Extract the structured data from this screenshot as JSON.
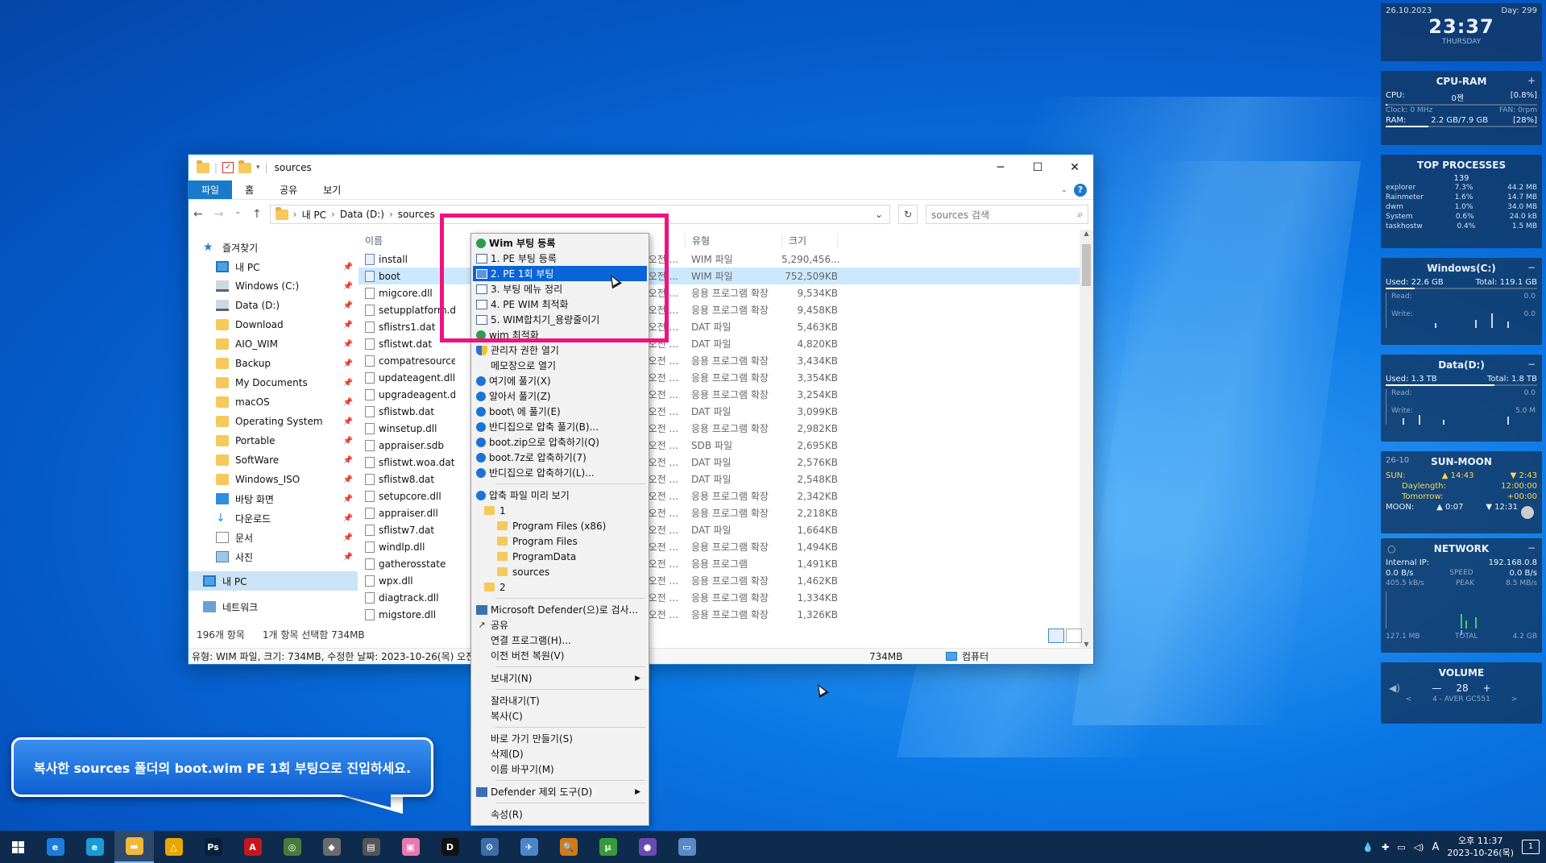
{
  "window": {
    "title": "sources",
    "tabs": [
      "파일",
      "홈",
      "공유",
      "보기"
    ],
    "controls": {
      "minimize": "─",
      "maximize": "☐",
      "close": "✕"
    },
    "help": "?"
  },
  "address": {
    "crumbs": [
      "내 PC",
      "Data (D:)",
      "sources"
    ],
    "search_placeholder": "sources 검색"
  },
  "nav_pane": {
    "quick_access": "즐겨찾기",
    "items": [
      {
        "label": "내 PC",
        "icon": "pc",
        "pinned": true
      },
      {
        "label": "Windows (C:)",
        "icon": "drive",
        "pinned": true
      },
      {
        "label": "Data (D:)",
        "icon": "drive",
        "pinned": true
      },
      {
        "label": "Download",
        "icon": "folder",
        "pinned": true
      },
      {
        "label": "AIO_WIM",
        "icon": "folder",
        "pinned": true
      },
      {
        "label": "Backup",
        "icon": "folder",
        "pinned": true
      },
      {
        "label": "My Documents",
        "icon": "folder",
        "pinned": true
      },
      {
        "label": "macOS",
        "icon": "folder",
        "pinned": true
      },
      {
        "label": "Operating System",
        "icon": "folder",
        "pinned": true
      },
      {
        "label": "Portable",
        "icon": "folder",
        "pinned": true
      },
      {
        "label": "SoftWare",
        "icon": "folder",
        "pinned": true
      },
      {
        "label": "Windows_ISO",
        "icon": "folder",
        "pinned": true
      },
      {
        "label": "바탕 화면",
        "icon": "desktop",
        "pinned": true
      },
      {
        "label": "다운로드",
        "icon": "download",
        "pinned": true
      },
      {
        "label": "문서",
        "icon": "document",
        "pinned": true
      },
      {
        "label": "사진",
        "icon": "picture",
        "pinned": true
      }
    ],
    "this_pc": "내 PC",
    "network": "네트워크",
    "pin_glyph": "📌"
  },
  "columns": {
    "name": "이름",
    "type": "유형",
    "size": "크기"
  },
  "files": [
    {
      "name": "install",
      "icon": "wim",
      "date": "오전 ...",
      "type": "WIM 파일",
      "size": "5,290,456..."
    },
    {
      "name": "boot",
      "icon": "wim",
      "date": "오전 ...",
      "type": "WIM 파일",
      "size": "752,509KB",
      "selected": true
    },
    {
      "name": "migcore.dll",
      "icon": "file",
      "date": "오전 ...",
      "type": "응용 프로그램 확장",
      "size": "9,534KB"
    },
    {
      "name": "setupplatform.dll",
      "icon": "file",
      "date": "오전 ...",
      "type": "응용 프로그램 확장",
      "size": "9,458KB"
    },
    {
      "name": "sflistrs1.dat",
      "icon": "file",
      "date": "오전 ...",
      "type": "DAT 파일",
      "size": "5,463KB"
    },
    {
      "name": "sflistwt.dat",
      "icon": "file",
      "date": "오전 ...",
      "type": "DAT 파일",
      "size": "4,820KB"
    },
    {
      "name": "compatresources.dll",
      "icon": "file",
      "date": "오전 ...",
      "type": "응용 프로그램 확장",
      "size": "3,434KB"
    },
    {
      "name": "updateagent.dll",
      "icon": "file",
      "date": "오전 ...",
      "type": "응용 프로그램 확장",
      "size": "3,354KB"
    },
    {
      "name": "upgradeagent.dll",
      "icon": "file",
      "date": "오전 ...",
      "type": "응용 프로그램 확장",
      "size": "3,254KB"
    },
    {
      "name": "sflistwb.dat",
      "icon": "file",
      "date": "오전 ...",
      "type": "DAT 파일",
      "size": "3,099KB"
    },
    {
      "name": "winsetup.dll",
      "icon": "file",
      "date": "오전 ...",
      "type": "응용 프로그램 확장",
      "size": "2,982KB"
    },
    {
      "name": "appraiser.sdb",
      "icon": "file",
      "date": "오전 ...",
      "type": "SDB 파일",
      "size": "2,695KB"
    },
    {
      "name": "sflistwt.woa.dat",
      "icon": "file",
      "date": "오전 ...",
      "type": "DAT 파일",
      "size": "2,576KB"
    },
    {
      "name": "sflistw8.dat",
      "icon": "file",
      "date": "오전 ...",
      "type": "DAT 파일",
      "size": "2,548KB"
    },
    {
      "name": "setupcore.dll",
      "icon": "file",
      "date": "오전 ...",
      "type": "응용 프로그램 확장",
      "size": "2,342KB"
    },
    {
      "name": "appraiser.dll",
      "icon": "file",
      "date": "오전 ...",
      "type": "응용 프로그램 확장",
      "size": "2,218KB"
    },
    {
      "name": "sflistw7.dat",
      "icon": "file",
      "date": "오전 ...",
      "type": "DAT 파일",
      "size": "1,664KB"
    },
    {
      "name": "windlp.dll",
      "icon": "file",
      "date": "오전 ...",
      "type": "응용 프로그램 확장",
      "size": "1,494KB"
    },
    {
      "name": "gatherosstate",
      "icon": "file",
      "date": "오전 ...",
      "type": "응용 프로그램",
      "size": "1,491KB"
    },
    {
      "name": "wpx.dll",
      "icon": "file",
      "date": "오전 ...",
      "type": "응용 프로그램 확장",
      "size": "1,462KB"
    },
    {
      "name": "diagtrack.dll",
      "icon": "file",
      "date": "오전 ...",
      "type": "응용 프로그램 확장",
      "size": "1,334KB"
    },
    {
      "name": "migstore.dll",
      "icon": "file",
      "date": "오전 ...",
      "type": "응용 프로그램 확장",
      "size": "1,326KB"
    }
  ],
  "status": {
    "count": "196개 항목",
    "selected": "1개 항목 선택함 734MB",
    "detail": "유형: WIM 파일, 크기: 734MB, 수정한 날짜: 2023-10-26(목) 오전 7:...",
    "size": "734MB",
    "location": "컴퓨터"
  },
  "context_menu": {
    "items": [
      {
        "label": "Wim 부팅 등록",
        "icon": "green",
        "bold": true
      },
      {
        "label": "1. PE 부팅 등록",
        "icon": "box"
      },
      {
        "label": "2. PE 1회 부팅",
        "icon": "box",
        "highlighted": true
      },
      {
        "label": "3. 부팅 메뉴 정리",
        "icon": "box"
      },
      {
        "label": "4. PE WIM 최적화",
        "icon": "box"
      },
      {
        "label": "5. WIM합치기_용량줄이기",
        "icon": "box"
      },
      {
        "label": "wim 최적화",
        "icon": "green"
      },
      {
        "label": "관리자 권한 열기",
        "icon": "shield"
      },
      {
        "label": "메모장으로 열기",
        "icon": "blank"
      },
      {
        "label": "여기에 풀기(X)",
        "icon": "round"
      },
      {
        "label": "알아서 풀기(Z)",
        "icon": "round"
      },
      {
        "label": "boot\\ 에 풀기(E)",
        "icon": "round"
      },
      {
        "label": "반디집으로 압축 풀기(B)...",
        "icon": "round"
      },
      {
        "label": "boot.zip으로 압축하기(Q)",
        "icon": "round"
      },
      {
        "label": "boot.7z로 압축하기(7)",
        "icon": "round"
      },
      {
        "label": "반디집으로 압축하기(L)...",
        "icon": "round"
      },
      {
        "sep": true
      },
      {
        "label": "압축 파일 미리 보기",
        "icon": "round"
      },
      {
        "label": "1",
        "folder": true,
        "level": 1
      },
      {
        "label": "Program Files (x86)",
        "folder": true,
        "level": 2
      },
      {
        "label": "Program Files",
        "folder": true,
        "level": 2
      },
      {
        "label": "ProgramData",
        "folder": true,
        "level": 2
      },
      {
        "label": "sources",
        "folder": true,
        "level": 2
      },
      {
        "label": "2",
        "folder": true,
        "level": 1
      },
      {
        "sep": true
      },
      {
        "label": "Microsoft Defender(으)로 검사...",
        "icon": "defender"
      },
      {
        "label": "공유",
        "icon": "share"
      },
      {
        "label": "연결 프로그램(H)...",
        "icon": "blank"
      },
      {
        "label": "이전 버전 복원(V)",
        "icon": "blank"
      },
      {
        "sep": true
      },
      {
        "label": "보내기(N)",
        "icon": "blank",
        "submenu": true
      },
      {
        "sep": true
      },
      {
        "label": "잘라내기(T)",
        "icon": "blank"
      },
      {
        "label": "복사(C)",
        "icon": "blank"
      },
      {
        "sep": true
      },
      {
        "label": "바로 가기 만들기(S)",
        "icon": "blank"
      },
      {
        "label": "삭제(D)",
        "icon": "blank"
      },
      {
        "label": "이름 바꾸기(M)",
        "icon": "blank"
      },
      {
        "sep": true
      },
      {
        "label": "Defender 제외 도구(D)",
        "icon": "defender",
        "submenu": true
      },
      {
        "sep": true
      },
      {
        "label": "속성(R)",
        "icon": "blank"
      }
    ]
  },
  "callout": {
    "text": "복사한 sources 폴더의 boot.wim PE 1회 부팅으로 진입하세요."
  },
  "widgets": {
    "clock": {
      "date": "26.10.2023",
      "day_num": "Day: 299",
      "time": "23:37",
      "weekday": "THURSDAY"
    },
    "cpu_ram": {
      "title": "CPU-RAM",
      "cpu_label": "CPU:",
      "cpu_name": "0젠",
      "cpu_pct": "[0.8%]",
      "clock": "Clock: 0 MHz",
      "fan": "FAN: 0rpm",
      "ram_label": "RAM:",
      "ram_val": "2.2 GB/7.9 GB",
      "ram_pct": "[28%]",
      "cpu_fraction": 0.008,
      "ram_fraction": 0.28
    },
    "top": {
      "title": "TOP PROCESSES",
      "count": "139",
      "rows": [
        [
          "explorer",
          "7.3%",
          "44.2 MB"
        ],
        [
          "Rainmeter",
          "1.6%",
          "14.7 MB"
        ],
        [
          "dwm",
          "1.0%",
          "34.0 MB"
        ],
        [
          "System",
          "0.6%",
          "24.0 kB"
        ],
        [
          "taskhostw",
          "0.4%",
          "1.5 MB"
        ]
      ]
    },
    "drive_c": {
      "title": "Windows(C:)",
      "used": "Used: 22.6 GB",
      "total": "Total: 119.1 GB",
      "read": "Read:",
      "write": "Write:",
      "read_val": "0.0",
      "write_val": "0.0",
      "used_fraction": 0.19
    },
    "drive_d": {
      "title": "Data(D:)",
      "used": "Used: 1.3 TB",
      "total": "Total: 1.8 TB",
      "read": "Read:",
      "write": "Write:",
      "read_val": "0.0",
      "write_val": "5.0 M",
      "used_fraction": 0.72
    },
    "sun": {
      "title": "SUN-MOON",
      "date": "26-10",
      "sun_label": "SUN:",
      "rise": "▲ 14:43",
      "set": "▼ 2:43",
      "daylength_label": "Daylength:",
      "daylength": "12:00:00",
      "tomorrow_label": "Tomorrow:",
      "tomorrow": "+00:00",
      "moon_label": "MOON:",
      "moon_rise": "▲ 0:07",
      "moon_set": "▼ 12:31"
    },
    "network": {
      "title": "NETWORK",
      "ip_label": "Internal IP:",
      "ip": "192.168.0.8",
      "down": "0.0 B/s",
      "speed_label": "SPEED",
      "up": "0.0 B/s",
      "down2": "405.5 kB/s",
      "peak_label": "PEAK",
      "up2": "8.5 MB/s",
      "total_left": "127.1 MB",
      "total_label": "TOTAL",
      "total_right": "4.2 GB"
    },
    "volume": {
      "title": "VOLUME",
      "minus": "—",
      "level": "28",
      "plus": "+",
      "device": "4 - AVER GC551"
    }
  },
  "taskbar": {
    "apps": [
      {
        "name": "internet-explorer",
        "glyph": "e",
        "color": "#1e7bd8"
      },
      {
        "name": "edge",
        "glyph": "e",
        "color": "#1a9ad6"
      },
      {
        "name": "file-explorer",
        "glyph": "▬",
        "color": "#f0b93a",
        "active": true
      },
      {
        "name": "app-yellow-triangle",
        "glyph": "△",
        "color": "#e8a700"
      },
      {
        "name": "photoshop",
        "glyph": "Ps",
        "color": "#0a1f3c"
      },
      {
        "name": "acrobat",
        "glyph": "A",
        "color": "#c6161d"
      },
      {
        "name": "tool-globe",
        "glyph": "◎",
        "color": "#4a7a3a"
      },
      {
        "name": "tool-diamond",
        "glyph": "◆",
        "color": "#6b6b6b"
      },
      {
        "name": "tool-printer",
        "glyph": "▤",
        "color": "#555"
      },
      {
        "name": "tool-pink",
        "glyph": "▣",
        "color": "#e87ab0"
      },
      {
        "name": "tool-d",
        "glyph": "D",
        "color": "#111"
      },
      {
        "name": "tool-gears",
        "glyph": "⚙",
        "color": "#3b6ea8"
      },
      {
        "name": "tool-bird",
        "glyph": "✈",
        "color": "#4d86c8"
      },
      {
        "name": "tool-search",
        "glyph": "🔍",
        "color": "#d07a1a"
      },
      {
        "name": "tool-torrent",
        "glyph": "µ",
        "color": "#3a9a3a"
      },
      {
        "name": "tool-ball",
        "glyph": "●",
        "color": "#6b4ab0"
      },
      {
        "name": "tool-card",
        "glyph": "▭",
        "color": "#5a8ac8"
      }
    ],
    "tray": {
      "ime": "A",
      "time": "오후 11:37",
      "date": "2023-10-26(목)",
      "notifications": "1"
    }
  }
}
